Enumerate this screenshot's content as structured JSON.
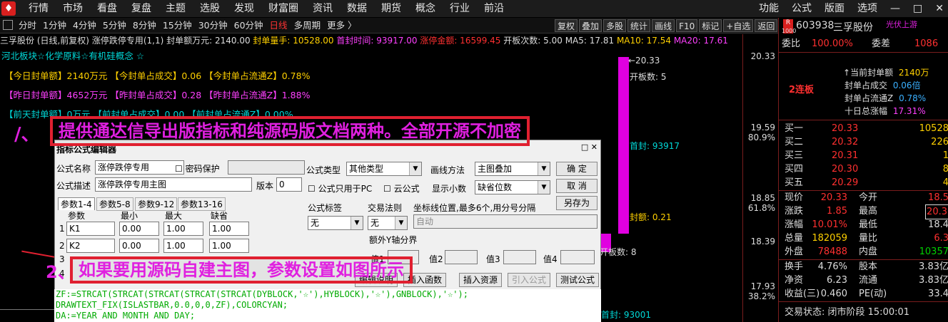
{
  "menubar": {
    "logo": "♦",
    "items": [
      "行情",
      "市场",
      "看盘",
      "复盘",
      "主题",
      "选股",
      "发现",
      "财富圈",
      "资讯",
      "数据",
      "期货",
      "概念",
      "行业",
      "前沿"
    ],
    "right": [
      "功能",
      "公式",
      "版面",
      "选项"
    ],
    "win": [
      "—",
      "□",
      "✕"
    ]
  },
  "periods": [
    "分时",
    "1分钟",
    "4分钟",
    "5分钟",
    "8分钟",
    "15分钟",
    "30分钟",
    "60分钟",
    "日线",
    "多周期",
    "更多 〉"
  ],
  "tools": [
    "复权",
    "叠加",
    "多股",
    "统计",
    "画线",
    "F10",
    "标记",
    "+自选",
    "返回"
  ],
  "info": {
    "name": "三孚股份 (日线,前复权)",
    "ind": "涨停跌停专用(1,1)",
    "fengdan": "封单额万元: 2140.00",
    "liang": "封单量手: 10528.00",
    "time": "首封时间: 93917.00",
    "jine": "涨停金额: 16599.45",
    "kaiban": "开板次数: 5.00",
    "ma5": "MA5: 17.81",
    "ma10": "MA10: 17.54",
    "ma20": "MA20: 17.61"
  },
  "concept": "河北板块☆化学原料☆有机硅概念 ☆",
  "lines": [
    {
      "a": "【今日封单额】",
      "b": "2140万元",
      "c": "【今封单占成交】",
      "d": "0.06",
      "e": "【今封单占流通Z】",
      "f": "0.78%"
    },
    {
      "a": "【昨日封单额】",
      "b": "4652万元",
      "c": "【昨封单占成交】",
      "d": "0.28",
      "e": "【昨封单占流通Z】",
      "f": "1.88%"
    },
    {
      "a": "【前天封单额】",
      "b": "0万元",
      "c": "【前封单占成交】",
      "d": "0.00",
      "e": "【前封单占流通Z】",
      "f": "0.00%"
    }
  ],
  "chart": {
    "top": "←20.33",
    "kb": "开板数: 5",
    "sf": "首封: 93917",
    "fe": "封额: 0.21",
    "kb2": "开板数: 8",
    "sf2": "首封: 93001"
  },
  "axis": [
    {
      "v": "20.33",
      "p": ""
    },
    {
      "v": "19.59",
      "p": "80.9%"
    },
    {
      "v": "18.85",
      "p": "61.8%"
    },
    {
      "v": "18.39",
      "p": ""
    },
    {
      "v": "17.93",
      "p": "38.2%"
    }
  ],
  "banner1": "提供通达信导出版指标和纯源码版文档两种。全部开源不加密",
  "banner1_num": "/、",
  "banner2": "如果要用源码自建主图，参数设置如图所示",
  "banner2_num": "2、",
  "dialog": {
    "title": "指标公式编辑器",
    "name_label": "公式名称",
    "name": "涨停跌停专用",
    "pwd": "密码保护",
    "desc_label": "公式描述",
    "desc": "涨停跌停专用主图",
    "ver_label": "版本",
    "ver": "0",
    "type_label": "公式类型",
    "type": "其他类型",
    "draw_label": "画线方法",
    "draw": "主图叠加",
    "ok": "确  定",
    "cancel": "取  消",
    "saveas": "另存为",
    "only_pc": "公式只用于PC",
    "cloud": "云公式",
    "decimals_label": "显示小数",
    "decimals": "缺省位数",
    "tabs": [
      "参数1-4",
      "参数5-8",
      "参数9-12",
      "参数13-16"
    ],
    "cols": [
      "参数",
      "最小",
      "最大",
      "缺省"
    ],
    "params": [
      {
        "n": "1",
        "p": "K1",
        "min": "0.00",
        "max": "1.00",
        "def": "1.00"
      },
      {
        "n": "2",
        "p": "K2",
        "min": "0.00",
        "max": "1.00",
        "def": "1.00"
      },
      {
        "n": "3",
        "p": "",
        "min": "",
        "max": "",
        "def": ""
      },
      {
        "n": "4",
        "p": "",
        "min": "",
        "max": "",
        "def": ""
      }
    ],
    "tag_label": "公式标签",
    "tag": "无",
    "rule_label": "交易法则",
    "rule": "无",
    "pos_label": "坐标线位置,最多6个,用分号分隔",
    "pos": "自动",
    "yaxis": "额外Y轴分界",
    "v1": "值1",
    "v2": "值2",
    "v3": "值3",
    "v4": "值4",
    "b1": "编辑说明",
    "b2": "插入函数",
    "b3": "插入资源",
    "b4": "引入公式",
    "b5": "测试公式"
  },
  "code": [
    "ZF:=STRCAT(STRCAT(STRCAT(STRCAT(STRCAT(DYBLOCK,'☆'),HYBLOCK),'☆'),GNBLOCK),'☆');",
    "DRAWTEXT_FIX(ISLASTBAR,0.0,0,0,ZF),COLORCYAN;",
    "DA:=YEAR AND MONTH AND DAY;"
  ],
  "side": {
    "code": "603938",
    "name": "三孚股份",
    "tag": "光伏上游",
    "rz": "R",
    "num": "1000",
    "wb_l": "委比",
    "wb": "100.00%",
    "wc_l": "委差",
    "wc": "1086",
    "lb": "2连板",
    "stats": [
      {
        "l": "当前封单额",
        "v": "2140万"
      },
      {
        "l": "封单占成交",
        "v": "0.06倍"
      },
      {
        "l": "封单占流通Z",
        "v": "0.78%"
      },
      {
        "l": "十日总涨幅",
        "v": "17.31%"
      }
    ],
    "buys": [
      {
        "l": "买一",
        "p": "20.33",
        "v": "10528"
      },
      {
        "l": "买二",
        "p": "20.32",
        "v": "226"
      },
      {
        "l": "买三",
        "p": "20.31",
        "v": "1"
      },
      {
        "l": "买四",
        "p": "20.30",
        "v": "8"
      },
      {
        "l": "买五",
        "p": "20.29",
        "v": "4"
      }
    ],
    "q": [
      {
        "a": "现价",
        "b": "20.33",
        "c": "今开",
        "d": "18.5"
      },
      {
        "a": "涨跌",
        "b": "1.85",
        "c": "最高",
        "d": "20.3"
      },
      {
        "a": "涨幅",
        "b": "10.01%",
        "c": "最低",
        "d": "18.4"
      },
      {
        "a": "总量",
        "b": "182059",
        "c": "量比",
        "d": "6.3"
      },
      {
        "a": "外盘",
        "b": "78488",
        "c": "内盘",
        "d": "10357"
      }
    ],
    "q2": [
      {
        "a": "换手",
        "b": "4.76%",
        "c": "股本",
        "d": "3.83亿"
      },
      {
        "a": "净资",
        "b": "6.23",
        "c": "流通",
        "d": "3.83亿"
      },
      {
        "a": "收益(三)",
        "b": "0.460",
        "c": "PE(动)",
        "d": "33.4"
      }
    ],
    "status": "交易状态: 闭市阶段 15:00:01"
  }
}
